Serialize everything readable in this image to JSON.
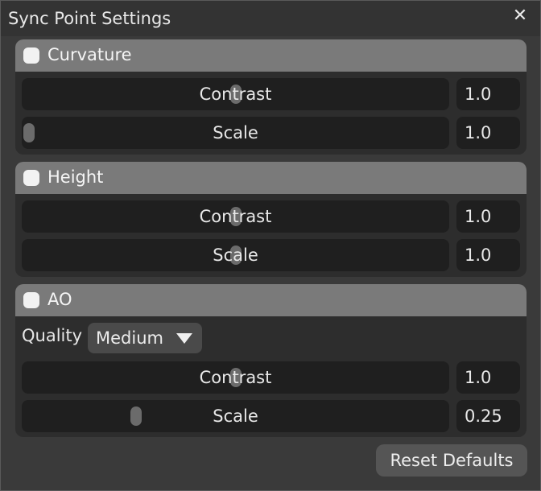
{
  "window": {
    "title": "Sync Point Settings",
    "close_glyph": "✕"
  },
  "panels": [
    {
      "title": "Curvature",
      "enabled": true,
      "sliders": [
        {
          "label": "Contrast",
          "value": "1.0",
          "level": 0.5
        },
        {
          "label": "Scale",
          "value": "1.0",
          "level": 0.0
        }
      ]
    },
    {
      "title": "Height",
      "enabled": true,
      "sliders": [
        {
          "label": "Contrast",
          "value": "1.0",
          "level": 0.5
        },
        {
          "label": "Scale",
          "value": "1.0",
          "level": 0.5
        }
      ]
    },
    {
      "title": "AO",
      "enabled": true,
      "quality": {
        "label": "Quality",
        "value": "Medium"
      },
      "sliders": [
        {
          "label": "Contrast",
          "value": "1.0",
          "level": 0.5
        },
        {
          "label": "Scale",
          "value": "0.25",
          "level": 0.26
        }
      ]
    }
  ],
  "footer": {
    "reset_label": "Reset Defaults"
  },
  "colors": {
    "panel_header": "#7a7a7a",
    "slider_track": "#1f1f1f",
    "thumb": "#6b6b6b"
  }
}
